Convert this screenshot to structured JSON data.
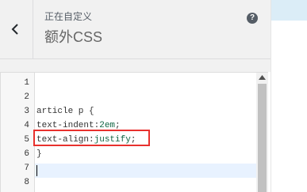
{
  "header": {
    "back_icon": "chevron-left-icon",
    "subtitle": "正在自定义",
    "title": "额外CSS",
    "help_label": "?"
  },
  "editor": {
    "line_numbers": [
      "1",
      "2",
      "3",
      "4",
      "5",
      "6",
      "7",
      "8"
    ],
    "lines": [
      [],
      [],
      [
        {
          "t": "article p {"
        }
      ],
      [
        {
          "t": "text-indent:"
        },
        {
          "t": "2em",
          "c": "val"
        },
        {
          "t": ";"
        }
      ],
      [
        {
          "t": "text-align:"
        },
        {
          "t": "justify",
          "c": "val"
        },
        {
          "t": ";"
        }
      ],
      [
        {
          "t": "}"
        }
      ],
      [],
      []
    ]
  },
  "colors": {
    "highlight_border": "#e8312d",
    "value_token": "#116644",
    "active_line": "#e8f2ff"
  }
}
